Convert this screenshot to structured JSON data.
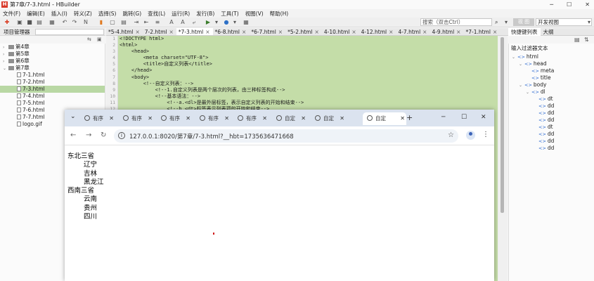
{
  "window": {
    "title": "第7章/7-3.html - HBuilder",
    "app_icon": "H",
    "controls": [
      "─",
      "☐",
      "✕"
    ]
  },
  "menu": [
    "文件(F)",
    "编辑(E)",
    "插入(I)",
    "转义(Z)",
    "选择(S)",
    "跳转(G)",
    "查找(L)",
    "运行(R)",
    "发行(B)",
    "工具(T)",
    "视图(V)",
    "帮助(H)"
  ],
  "toolbar": {
    "search_placeholder": "搜索（双击Ctrl）",
    "view_button": "视 图",
    "dev_view": "开发视图"
  },
  "project": {
    "title": "项目管理器",
    "items": [
      {
        "label": "第4章",
        "kind": "folder",
        "arrow": "›",
        "selected": false
      },
      {
        "label": "第5章",
        "kind": "folder",
        "arrow": "›",
        "selected": false
      },
      {
        "label": "第6章",
        "kind": "folder",
        "arrow": "›",
        "selected": false
      },
      {
        "label": "第7章",
        "kind": "folder",
        "arrow": "⌄",
        "selected": false
      },
      {
        "label": "7-1.html",
        "kind": "file",
        "arrow": "",
        "selected": false
      },
      {
        "label": "7-2.html",
        "kind": "file",
        "arrow": "",
        "selected": false
      },
      {
        "label": "7-3.html",
        "kind": "file",
        "arrow": "",
        "selected": true
      },
      {
        "label": "7-4.html",
        "kind": "file",
        "arrow": "",
        "selected": false
      },
      {
        "label": "7-5.html",
        "kind": "file",
        "arrow": "",
        "selected": false
      },
      {
        "label": "7-6.html",
        "kind": "file",
        "arrow": "",
        "selected": false
      },
      {
        "label": "7-7.html",
        "kind": "file",
        "arrow": "",
        "selected": false
      },
      {
        "label": "logo.gif",
        "kind": "file",
        "arrow": "",
        "selected": false
      }
    ]
  },
  "editor_tabs": [
    "*5-4.html",
    "7-2.html",
    "*7-3.html",
    "*6-8.html",
    "*6-7.html",
    "*5-2.html",
    "4-10.html",
    "4-12.html",
    "4-7.html",
    "4-9.html",
    "*7-1.html"
  ],
  "editor_lines": [
    "<!DOCTYPE html>",
    "<html>",
    "    <head>",
    "        <meta charset=\"UTF-8\">",
    "        <title>自定义列表</title>",
    "    </head>",
    "    <body>",
    "        <!--自定义列表：-->",
    "            <!--1.自定义列表是两个层次的列表，由三种标签构成-->",
    "            <!--基本语法：-->",
    "                <!--a.<dl>是最外层标签，表示自定义列表的开始和结束-->",
    "                <!--b.<dt>标签表示列表项的开始和结束-->"
  ],
  "outline": {
    "tabs": [
      "快捷键列表",
      "大纲"
    ],
    "filter_label": "输入过滤器文本",
    "items": [
      {
        "label": "html",
        "depth": 0,
        "arrow": "⌄"
      },
      {
        "label": "head",
        "depth": 1,
        "arrow": "⌄"
      },
      {
        "label": "meta",
        "depth": 2,
        "arrow": ""
      },
      {
        "label": "title",
        "depth": 2,
        "arrow": ""
      },
      {
        "label": "body",
        "depth": 1,
        "arrow": "⌄"
      },
      {
        "label": "dl",
        "depth": 2,
        "arrow": "⌄"
      },
      {
        "label": "dt",
        "depth": 3,
        "arrow": ""
      },
      {
        "label": "dd",
        "depth": 3,
        "arrow": ""
      },
      {
        "label": "dd",
        "depth": 3,
        "arrow": ""
      },
      {
        "label": "dd",
        "depth": 3,
        "arrow": ""
      },
      {
        "label": "dt",
        "depth": 3,
        "arrow": ""
      },
      {
        "label": "dd",
        "depth": 3,
        "arrow": ""
      },
      {
        "label": "dd",
        "depth": 3,
        "arrow": ""
      },
      {
        "label": "dd",
        "depth": 3,
        "arrow": ""
      }
    ]
  },
  "browser": {
    "tabs": [
      "有序",
      "有序",
      "有序",
      "有序",
      "有序",
      "自定",
      "自定",
      "自定"
    ],
    "active_tab": 7,
    "url": "127.0.0.1:8020/第7章/7-3.html?__hbt=1735636471668",
    "content": [
      {
        "type": "dt",
        "text": "东北三省"
      },
      {
        "type": "dd",
        "text": "辽宁"
      },
      {
        "type": "dd",
        "text": "吉林"
      },
      {
        "type": "dd",
        "text": "黑龙江"
      },
      {
        "type": "dt",
        "text": "西南三省"
      },
      {
        "type": "dd",
        "text": "云南"
      },
      {
        "type": "dd",
        "text": "贵州"
      },
      {
        "type": "dd",
        "text": "四川"
      }
    ]
  }
}
